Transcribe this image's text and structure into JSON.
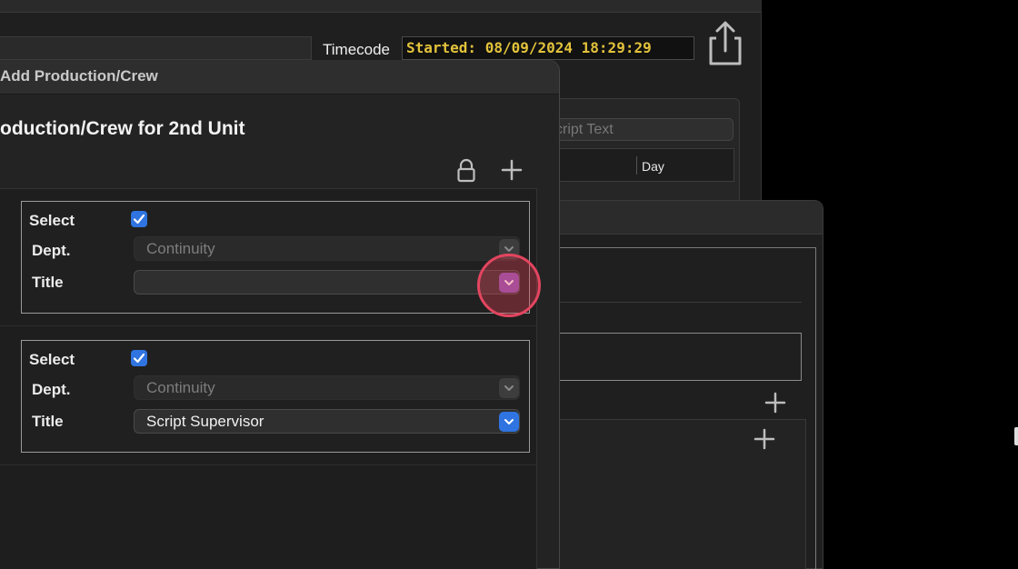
{
  "background_window": {
    "timecode_label": "Timecode",
    "timecode_value": "Started: 08/09/2024 18:29:29",
    "search_placeholder": "cript Text",
    "column_day": "Day",
    "share_icon": "share-icon"
  },
  "dialog": {
    "title": "Add Production/Crew",
    "heading": "oduction/Crew for 2nd Unit",
    "toolbar": {
      "lock_icon": "lock-icon",
      "add_icon": "plus-icon"
    },
    "entries": [
      {
        "select_label": "Select",
        "selected": true,
        "dept_label": "Dept.",
        "dept_value": "Continuity",
        "title_label": "Title",
        "title_value": ""
      },
      {
        "select_label": "Select",
        "selected": true,
        "dept_label": "Dept.",
        "dept_value": "Continuity",
        "title_label": "Title",
        "title_value": "Script Supervisor"
      }
    ]
  },
  "colors": {
    "timecode_text": "#e2c23b",
    "accent_blue": "#2f74e0",
    "click_highlight": "#e3455f"
  }
}
